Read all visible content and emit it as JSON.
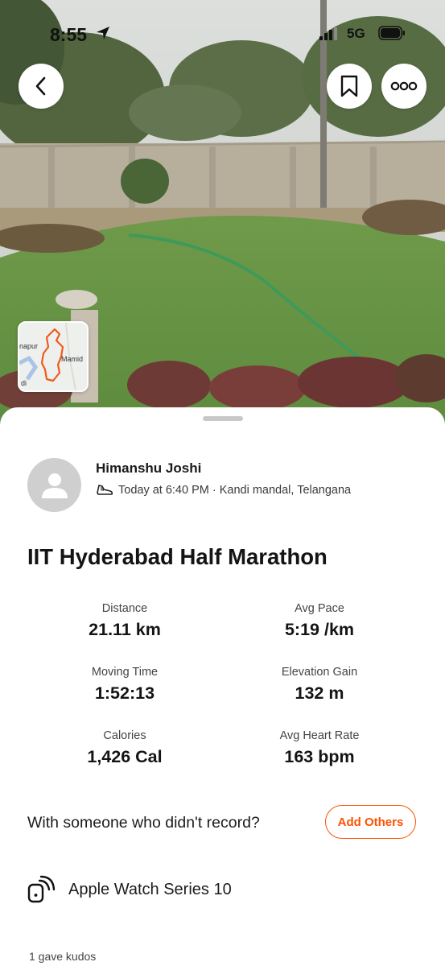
{
  "status_bar": {
    "time": "8:55",
    "network": "5G"
  },
  "map_thumbnail": {
    "labels": [
      "napur",
      "Mamid",
      "di"
    ],
    "route_color": "#f05a1a"
  },
  "athlete": {
    "name": "Himanshu Joshi",
    "timestamp_location": "Today at 6:40 PM · Kandi mandal, Telangana"
  },
  "activity": {
    "title": "IIT Hyderabad Half Marathon"
  },
  "stats": [
    {
      "label": "Distance",
      "value": "21.11 km"
    },
    {
      "label": "Avg Pace",
      "value": "5:19 /km"
    },
    {
      "label": "Moving Time",
      "value": "1:52:13"
    },
    {
      "label": "Elevation Gain",
      "value": "132 m"
    },
    {
      "label": "Calories",
      "value": "1,426 Cal"
    },
    {
      "label": "Avg Heart Rate",
      "value": "163 bpm"
    }
  ],
  "with_others": {
    "prompt": "With someone who didn't record?",
    "button_label": "Add Others"
  },
  "device": {
    "name": "Apple Watch Series 10"
  },
  "kudos": {
    "text": "1 gave kudos"
  },
  "colors": {
    "accent": "#fc5200"
  },
  "icons": [
    "location-arrow-icon",
    "signal-icon",
    "battery-icon",
    "back-icon",
    "bookmark-icon",
    "more-icon",
    "avatar-icon",
    "shoe-icon",
    "device-icon"
  ]
}
